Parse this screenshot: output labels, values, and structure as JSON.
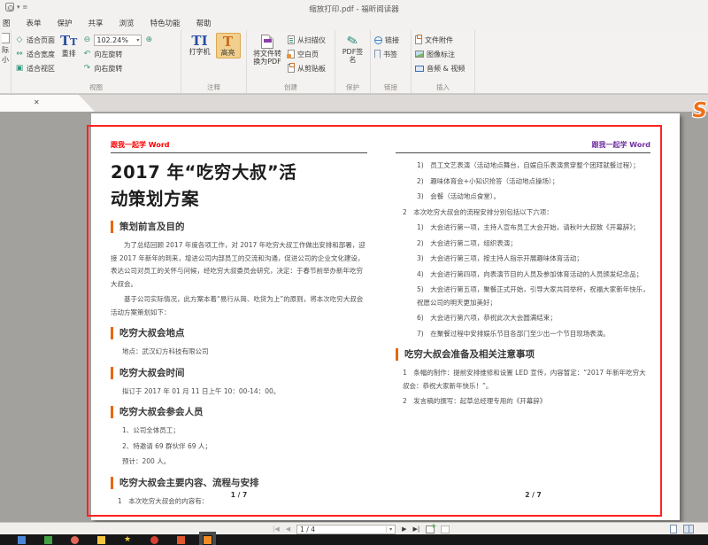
{
  "window": {
    "title": "缩放打印.pdf - 福昕阅读器"
  },
  "icons": {
    "close_tab": "✕",
    "dropdown": "▾",
    "qat_more": "≡",
    "zoom_out": "⊖",
    "zoom_in": "⊕",
    "rotate_left": "↶",
    "rotate_right": "↷",
    "fit_page": "◇",
    "fit_width": "⇔",
    "fit_visible": "▣",
    "nav_first": "|◀",
    "nav_prev": "◀",
    "nav_next": "▶",
    "nav_last": "▶|",
    "pen": "✎",
    "floating_s": "S"
  },
  "menubar": {
    "items": [
      "图",
      "表单",
      "保护",
      "共享",
      "浏览",
      "特色功能",
      "帮助"
    ]
  },
  "ribbon": {
    "view_group": {
      "partial_line1": "际",
      "partial_line2": "小",
      "fit_page": "适合页面",
      "fit_width": "适合宽度",
      "fit_visible": "适合视区",
      "reflow": "重排",
      "zoom_value": "102.24%",
      "rotate_left": "向左旋转",
      "rotate_right": "向右旋转",
      "label": "视图"
    },
    "comment_group": {
      "typewriter": "打字机",
      "highlight": "高亮",
      "label": "注释"
    },
    "create_group": {
      "convert": "将文件转换为PDF",
      "from_scanner": "从扫描仪",
      "blank_page": "空白页",
      "from_clipboard": "从剪贴板",
      "label": "创建"
    },
    "protect_group": {
      "pdf_sign": "PDF签名",
      "label": "保护"
    },
    "link_group": {
      "link": "链接",
      "bookmark": "书签",
      "label": "链接"
    },
    "insert_group": {
      "file_attach": "文件附件",
      "image_annot": "图像标注",
      "audio_video": "音频 & 视频",
      "label": "插入"
    }
  },
  "statusbar": {
    "page_field": "1 / 4"
  },
  "taskbar": {
    "apps": [
      {
        "name": "taskbar-app-blue",
        "color": "#4a86d8",
        "shape": "square"
      },
      {
        "name": "taskbar-app-green",
        "color": "#43a047",
        "shape": "square"
      },
      {
        "name": "taskbar-app-salmon-circle",
        "color": "#e3685a",
        "shape": "circle"
      },
      {
        "name": "taskbar-app-yellow",
        "color": "#f4c63f",
        "shape": "square"
      },
      {
        "name": "taskbar-app-star",
        "color": "#f2cb3a",
        "shape": "star"
      },
      {
        "name": "taskbar-app-red-circle",
        "color": "#d64133",
        "shape": "circle"
      },
      {
        "name": "taskbar-app-orange-red",
        "color": "#e0572e",
        "shape": "square"
      },
      {
        "name": "taskbar-app-orange",
        "color": "#f08a24",
        "shape": "square",
        "highlight": true
      }
    ]
  },
  "document": {
    "colors": {
      "brand1": "#FF0000",
      "brand2": "#7030A0",
      "heading_bar": "#E8670C",
      "annotation_border": "#FF2222"
    },
    "page1": {
      "brand": "跟我一起学 Word",
      "title": "2017 年“吃穷大叔”活动策划方案",
      "footer": "1 / 7",
      "blocks": [
        {
          "type": "heading",
          "text": "策划前言及目的"
        },
        {
          "type": "para",
          "text": "为了总结回顾 2017 年度各项工作，对 2017 年吃穷大叔工作做出安排和部署，迎接 2017 年新年的到来，增进公司内部员工的交流和沟通，促进公司的企业文化建设，表达公司对员工的关怀与问候，经吃穷大叔委员会研究，决定：于春节前举办新年吃穷大叔会。"
        },
        {
          "type": "para",
          "text": "基于公司实际情况，此方案本着“易行从简、吃货为上”的原则，将本次吃穷大叔会活动方案策划如下："
        },
        {
          "type": "heading",
          "text": "吃穷大叔会地点"
        },
        {
          "type": "p0",
          "text": "地点：武汉幻方科技有限公司"
        },
        {
          "type": "heading",
          "text": "吃穷大叔会时间"
        },
        {
          "type": "p0",
          "text": "拟订于 2017 年 01 月 11 日上午 10：00-14：00。"
        },
        {
          "type": "heading",
          "text": "吃穷大叔会参会人员"
        },
        {
          "type": "p0",
          "text": "1、公司全体员工；"
        },
        {
          "type": "p0",
          "text": "2、特邀请 69 群伙伴 69 人；"
        },
        {
          "type": "p0",
          "text": "预计：200 人。"
        },
        {
          "type": "heading",
          "text": "吃穷大叔会主要内容、流程与安排"
        },
        {
          "type": "li1",
          "text": "1　本次吃穷大叔会的内容有："
        }
      ]
    },
    "page2": {
      "brand": "跟我一起学 Word",
      "footer": "2 / 7",
      "blocks": [
        {
          "type": "li2",
          "text": "1)　员工文艺表演（活动地点舞台，自娱自乐表演贯穿整个团拜就餐过程）；"
        },
        {
          "type": "li2",
          "text": "2)　趣味体育会+小知识抢答（活动地点操场）；"
        },
        {
          "type": "li2",
          "text": "3)　会餐（活动地点食堂）。"
        },
        {
          "type": "li1",
          "text": "2　本次吃穷大叔会的流程安排分别包括以下六项："
        },
        {
          "type": "li2",
          "text": "1)　大会进行第一项，主持人宣布员工大会开始，请秋叶大叔致《开幕辞》；"
        },
        {
          "type": "li2",
          "text": "2)　大会进行第二项，组织表演；"
        },
        {
          "type": "li2",
          "text": "3)　大会进行第三项，按主持人指示开展趣味体育活动；"
        },
        {
          "type": "li2",
          "text": "4)　大会进行第四项，向表演节目的人员及参加体育活动的人员颁发纪念品；"
        },
        {
          "type": "li2",
          "text": "5)　大会进行第五项，聚餐正式开始，引导大家共同举杯，祝福大家新年快乐，祝愿公司的明天更加美好；"
        },
        {
          "type": "li2",
          "text": "6)　大会进行第六项，恭祝此次大会圆满结束；"
        },
        {
          "type": "li2",
          "text": "7)　在聚餐过程中安排娱乐节目各部门至少出一个节目现场表演。"
        },
        {
          "type": "heading",
          "text": "吃穷大叔会准备及相关注意事项"
        },
        {
          "type": "li1",
          "text": "1　条幅的制作：提前安排维修和设置 LED 宣传，内容暂定：“2017 年新年吃穷大叔会：恭祝大家新年快乐！”。"
        },
        {
          "type": "li1",
          "text": "2　发言稿的撰写：起草总经理专用的《开幕辞》"
        }
      ]
    }
  }
}
